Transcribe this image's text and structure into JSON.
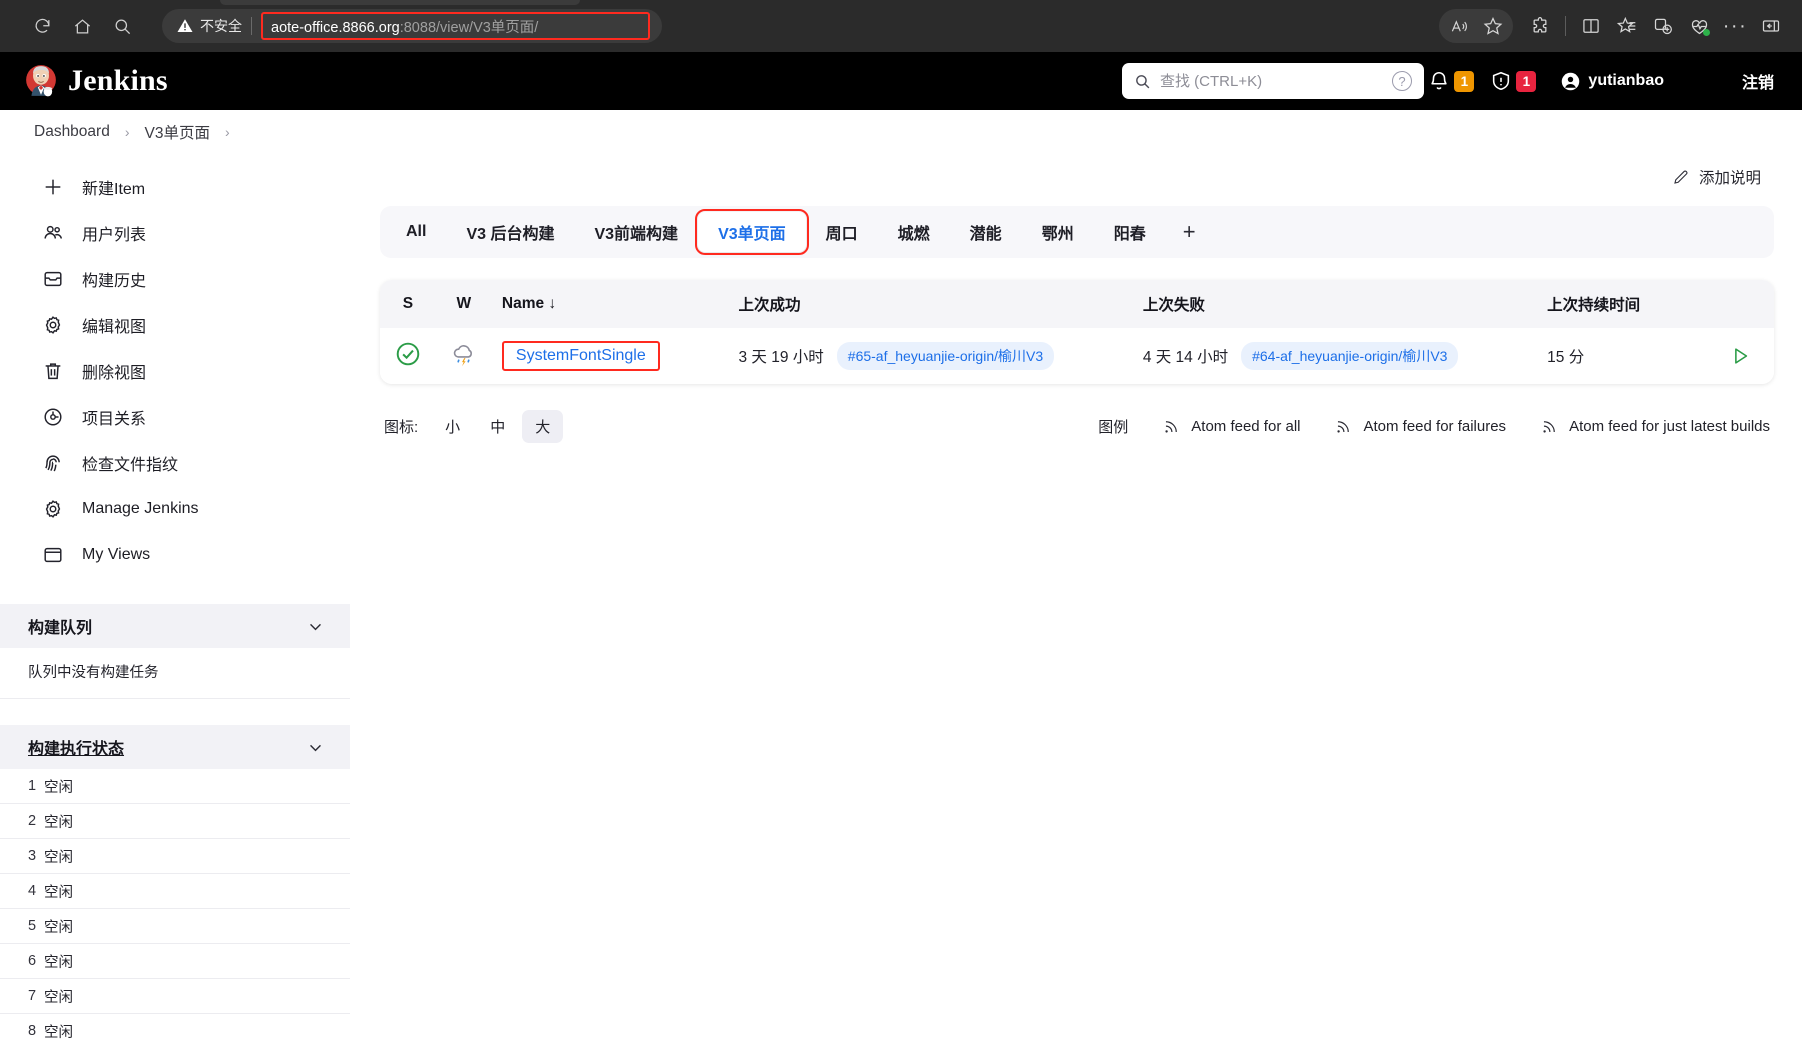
{
  "browser": {
    "nav": {
      "reload_icon": "reload-icon",
      "home_icon": "home-icon",
      "search_icon": "search-icon"
    },
    "address_bar": {
      "security_label": "不安全",
      "security_icon": "warning-triangle-icon",
      "url_host": "aote-office.8866.org",
      "url_path": ":8088/view/V3单页面/",
      "highlighted": true,
      "highlight_color": "#ff2a1f"
    },
    "toolbar_right": [
      {
        "name": "read-aloud-icon",
        "label": "Read aloud"
      },
      {
        "name": "favorite-star-icon",
        "label": "Add to favorites"
      },
      {
        "name": "extensions-icon",
        "label": "Extensions"
      },
      {
        "name": "split-screen-icon",
        "label": "Split screen"
      },
      {
        "name": "collections-icon",
        "label": "Collections"
      },
      {
        "name": "add-tab-group-icon",
        "label": "Add tab group"
      },
      {
        "name": "browser-essentials-icon",
        "label": "Browser essentials",
        "status_dot": "#2db14a"
      },
      {
        "name": "more-options-icon",
        "label": "Settings and more"
      },
      {
        "name": "sidebar-toggle-icon",
        "label": "Sidebar"
      }
    ]
  },
  "header": {
    "logo_text": "Jenkins",
    "search": {
      "placeholder": "查找 (CTRL+K)",
      "value": "",
      "icon": "search-icon",
      "help_icon": "help-circle-icon"
    },
    "notifications": {
      "icon": "bell-icon",
      "count": "1",
      "color": "#ef9600"
    },
    "security": {
      "icon": "shield-warning-icon",
      "count": "1",
      "color": "#e8243f"
    },
    "user": {
      "name": "yutianbao",
      "avatar_icon": "user-circle-icon",
      "chevron_icon": "chevron-down-icon"
    },
    "logout": {
      "label": "注销",
      "icon": "logout-icon"
    }
  },
  "breadcrumb": {
    "items": [
      {
        "label": "Dashboard"
      },
      {
        "label": "V3单页面"
      }
    ],
    "separator": "›"
  },
  "sidebar": {
    "items": [
      {
        "label": "新建Item",
        "icon": "plus-icon"
      },
      {
        "label": "用户列表",
        "icon": "people-icon"
      },
      {
        "label": "构建历史",
        "icon": "archive-icon"
      },
      {
        "label": "编辑视图",
        "icon": "gear-icon"
      },
      {
        "label": "删除视图",
        "icon": "trash-icon"
      },
      {
        "label": "项目关系",
        "icon": "relations-icon"
      },
      {
        "label": "检查文件指纹",
        "icon": "fingerprint-icon"
      },
      {
        "label": "Manage Jenkins",
        "icon": "gear-icon"
      },
      {
        "label": "My Views",
        "icon": "window-icon"
      }
    ],
    "build_queue": {
      "title": "构建队列",
      "empty_text": "队列中没有构建任务",
      "chevron_icon": "chevron-down-icon"
    },
    "build_executor_status": {
      "title": "构建执行状态",
      "chevron_icon": "chevron-down-icon",
      "executors": [
        {
          "num": "1",
          "status": "空闲"
        },
        {
          "num": "2",
          "status": "空闲"
        },
        {
          "num": "3",
          "status": "空闲"
        },
        {
          "num": "4",
          "status": "空闲"
        },
        {
          "num": "5",
          "status": "空闲"
        },
        {
          "num": "6",
          "status": "空闲"
        },
        {
          "num": "7",
          "status": "空闲"
        },
        {
          "num": "8",
          "status": "空闲"
        }
      ]
    }
  },
  "main": {
    "add_description": {
      "label": "添加说明",
      "icon": "pencil-icon"
    },
    "tabs": [
      {
        "label": "All",
        "active": false,
        "boxed": false
      },
      {
        "label": "V3 后台构建",
        "active": false,
        "boxed": false
      },
      {
        "label": "V3前端构建",
        "active": false,
        "boxed": false
      },
      {
        "label": "V3单页面",
        "active": true,
        "boxed": true
      },
      {
        "label": "周口",
        "active": false,
        "boxed": false
      },
      {
        "label": "城燃",
        "active": false,
        "boxed": false
      },
      {
        "label": "潜能",
        "active": false,
        "boxed": false
      },
      {
        "label": "鄂州",
        "active": false,
        "boxed": false
      },
      {
        "label": "阳春",
        "active": false,
        "boxed": false
      }
    ],
    "add_tab_label": "+",
    "table": {
      "columns": [
        "S",
        "W",
        "Name ↓",
        "上次成功",
        "上次失败",
        "上次持续时间"
      ],
      "rows": [
        {
          "status_icon": "success-check-icon",
          "status_color": "#2b9c47",
          "weather_icon": "storm-cloud-icon",
          "name": "SystemFontSingle",
          "name_boxed": true,
          "last_success_time": "3 天 19 小时",
          "last_success_build": "#65-af_heyuanjie-origin/榆川V3",
          "last_failure_time": "4 天 14 小时",
          "last_failure_build": "#64-af_heyuanjie-origin/榆川V3",
          "last_duration": "15 分",
          "action_icon": "play-build-icon"
        }
      ]
    },
    "footer": {
      "icon_size_label": "图标:",
      "icon_sizes": [
        {
          "label": "小",
          "active": false
        },
        {
          "label": "中",
          "active": false
        },
        {
          "label": "大",
          "active": true
        }
      ],
      "legend_label": "图例",
      "feeds": [
        {
          "label": "Atom feed for all",
          "icon": "rss-icon"
        },
        {
          "label": "Atom feed for failures",
          "icon": "rss-icon"
        },
        {
          "label": "Atom feed for just latest builds",
          "icon": "rss-icon"
        }
      ]
    }
  }
}
